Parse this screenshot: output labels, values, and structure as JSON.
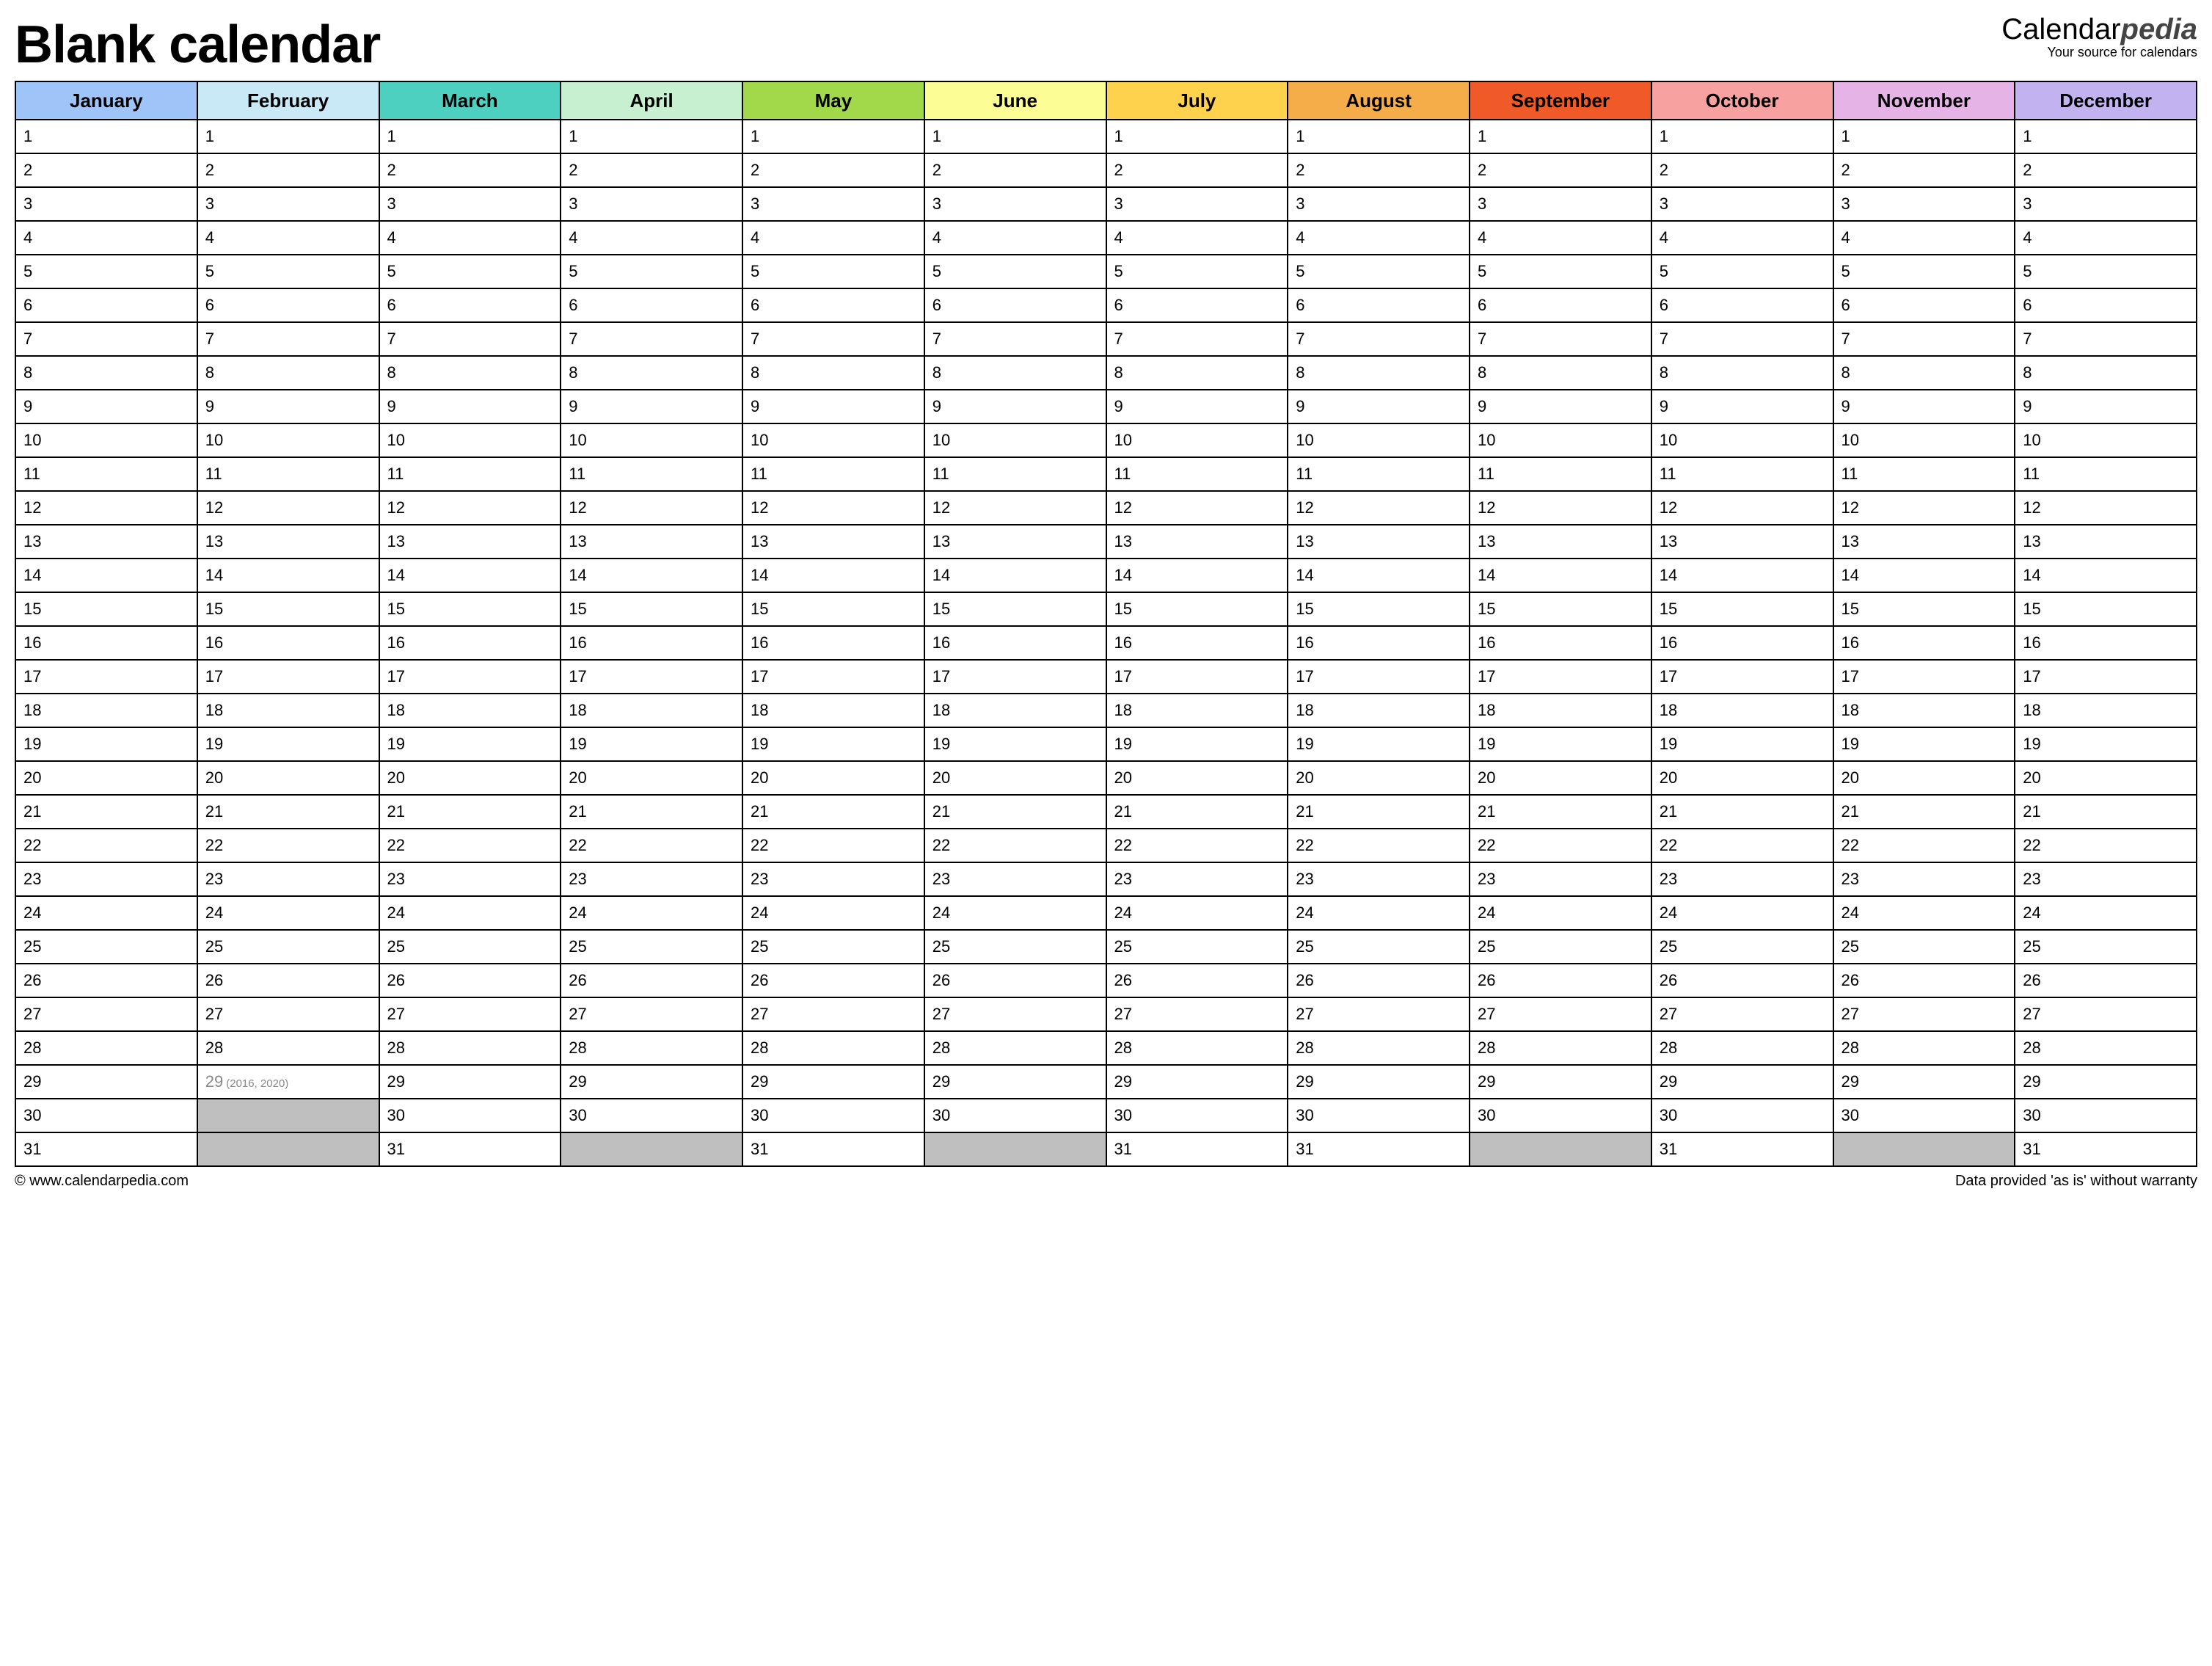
{
  "title": "Blank calendar",
  "brand": {
    "prefix": "Calendar",
    "suffix": "pedia",
    "tagline": "Your source for calendars"
  },
  "months": [
    {
      "name": "January",
      "color": "#9fc5f8",
      "days": 31
    },
    {
      "name": "February",
      "color": "#c9e9f6",
      "days": 29,
      "leap_day": 29,
      "leap_note": "(2016, 2020)"
    },
    {
      "name": "March",
      "color": "#4dd0c0",
      "days": 31
    },
    {
      "name": "April",
      "color": "#c6f0cf",
      "days": 30
    },
    {
      "name": "May",
      "color": "#a2d94a",
      "days": 31
    },
    {
      "name": "June",
      "color": "#fdfd96",
      "days": 30
    },
    {
      "name": "July",
      "color": "#ffd24d",
      "days": 31
    },
    {
      "name": "August",
      "color": "#f4ad49",
      "days": 31
    },
    {
      "name": "September",
      "color": "#f05a28",
      "days": 30
    },
    {
      "name": "October",
      "color": "#f7a1a1",
      "days": 31
    },
    {
      "name": "November",
      "color": "#e6b3e6",
      "days": 30
    },
    {
      "name": "December",
      "color": "#c2b3f0",
      "days": 31
    }
  ],
  "max_rows": 31,
  "footer": {
    "left": "© www.calendarpedia.com",
    "right": "Data provided 'as is' without warranty"
  }
}
